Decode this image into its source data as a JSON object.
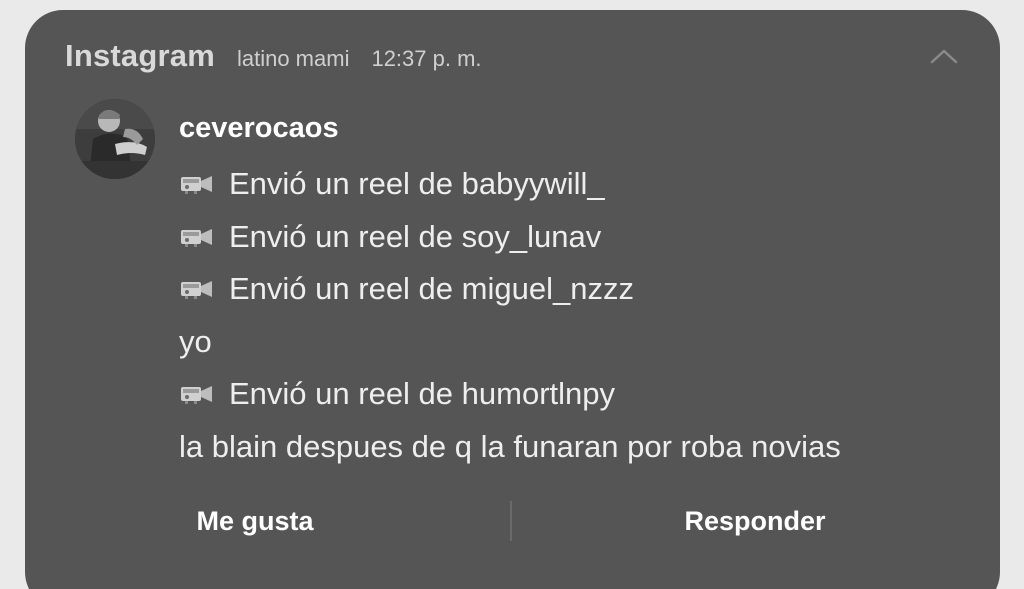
{
  "notification": {
    "app_name": "Instagram",
    "subtitle": "latino mami",
    "time": "12:37 p. m.",
    "collapse_icon": "chevron-up-icon",
    "avatar_icon": "profile-photo",
    "sender": "ceverocaos",
    "messages": [
      {
        "icon": "video-camera-icon",
        "text": "Envió un reel de babyywill_"
      },
      {
        "icon": "video-camera-icon",
        "text": "Envió un reel de soy_lunav"
      },
      {
        "icon": "video-camera-icon",
        "text": "Envió un reel de miguel_nzzz"
      },
      {
        "icon": "",
        "text": "yo"
      },
      {
        "icon": "video-camera-icon",
        "text": "Envió un reel de humortlnpy"
      },
      {
        "icon": "",
        "text": "la blain despues de q la funaran por roba novias"
      }
    ],
    "actions": {
      "like_label": "Me gusta",
      "reply_label": "Responder"
    }
  },
  "colors": {
    "card_background": "#555555",
    "page_background": "#eaeaea",
    "text_primary": "#ffffff",
    "text_secondary": "#cfcfcf"
  }
}
